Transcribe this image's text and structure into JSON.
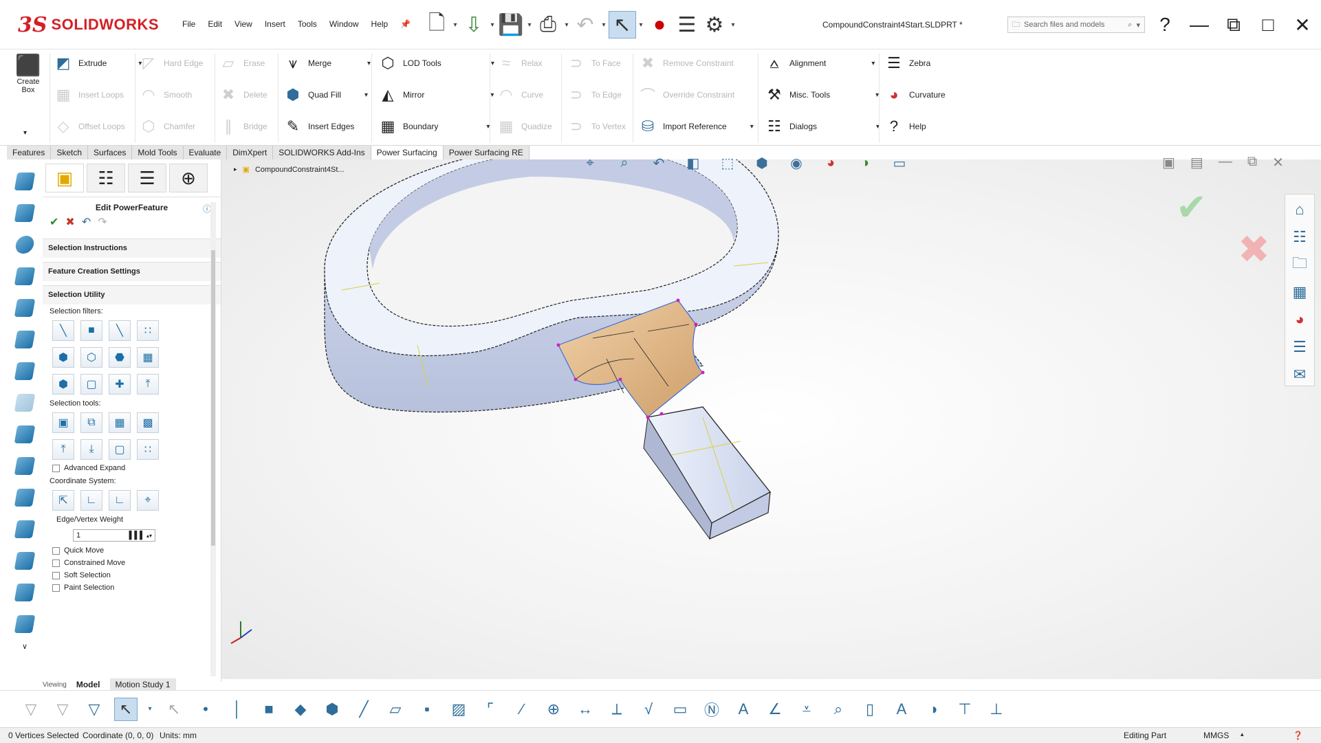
{
  "app": {
    "brand_ds": "3S",
    "brand_name": "SOLIDWORKS",
    "document_title": "CompoundConstraint4Start.SLDPRT *",
    "search_placeholder": "Search files and models"
  },
  "menu": [
    "File",
    "Edit",
    "View",
    "Insert",
    "Tools",
    "Window",
    "Help"
  ],
  "ribbon": {
    "create_box": "Create Box",
    "col1": [
      {
        "label": "Extrude",
        "enabled": true,
        "icon": "extrude-icon"
      },
      {
        "label": "Insert Loops",
        "enabled": false,
        "icon": "insert-loops-icon"
      },
      {
        "label": "Offset Loops",
        "enabled": false,
        "icon": "offset-loops-icon"
      }
    ],
    "col2": [
      {
        "label": "Hard Edge",
        "enabled": false
      },
      {
        "label": "Smooth",
        "enabled": false
      },
      {
        "label": "Chamfer",
        "enabled": false
      }
    ],
    "col3": [
      {
        "label": "Erase",
        "enabled": false
      },
      {
        "label": "Delete",
        "enabled": false
      },
      {
        "label": "Bridge",
        "enabled": false
      }
    ],
    "col4": [
      {
        "label": "Merge",
        "enabled": true
      },
      {
        "label": "Quad Fill",
        "enabled": true
      },
      {
        "label": "Insert Edges",
        "enabled": true
      }
    ],
    "col5": [
      {
        "label": "LOD Tools",
        "enabled": true
      },
      {
        "label": "Mirror",
        "enabled": true
      },
      {
        "label": "Boundary",
        "enabled": true
      }
    ],
    "col6": [
      {
        "label": "Relax",
        "enabled": false
      },
      {
        "label": "Curve",
        "enabled": false
      },
      {
        "label": "Quadize",
        "enabled": false
      }
    ],
    "col7": [
      {
        "label": "To Face",
        "enabled": false
      },
      {
        "label": "To Edge",
        "enabled": false
      },
      {
        "label": "To Vertex",
        "enabled": false
      }
    ],
    "col8": [
      {
        "label": "Remove Constraint",
        "enabled": false
      },
      {
        "label": "Override Constraint",
        "enabled": false
      },
      {
        "label": "Import Reference",
        "enabled": true
      }
    ],
    "col9": [
      {
        "label": "Alignment",
        "enabled": true
      },
      {
        "label": "Misc. Tools",
        "enabled": true
      },
      {
        "label": "Dialogs",
        "enabled": true
      }
    ],
    "col10": [
      {
        "label": "Zebra",
        "enabled": true
      },
      {
        "label": "Curvature",
        "enabled": true
      },
      {
        "label": "Help",
        "enabled": true
      }
    ]
  },
  "tabs": [
    "Features",
    "Sketch",
    "Surfaces",
    "Mold Tools",
    "Evaluate",
    "DimXpert",
    "SOLIDWORKS Add-Ins",
    "Power Surfacing",
    "Power Surfacing RE"
  ],
  "active_tab": "Power Surfacing",
  "panel": {
    "title": "Edit PowerFeature",
    "sections": {
      "selection_instructions": "Selection Instructions",
      "feature_creation_settings": "Feature Creation Settings",
      "selection_utility": "Selection Utility"
    },
    "selection_filters_label": "Selection filters:",
    "selection_tools_label": "Selection tools:",
    "advanced_expand": "Advanced Expand",
    "coordinate_system_label": "Coordinate System:",
    "edge_vertex_weight_label": "Edge/Vertex Weight",
    "weight_value": "1",
    "checkboxes": [
      "Quick Move",
      "Constrained Move",
      "Soft Selection",
      "Paint Selection"
    ],
    "viewing_label": "Viewing"
  },
  "tree": {
    "root": "CompoundConstraint4St..."
  },
  "bottom_tabs": {
    "model": "Model",
    "motion_study": "Motion Study 1"
  },
  "status": {
    "selected": "0 Vertices Selected",
    "coordinate": "Coordinate (0, 0, 0)",
    "units": "Units: mm",
    "mode": "Editing Part",
    "unit_system": "MMGS"
  },
  "colors": {
    "brand_red": "#d41f26",
    "body_face": "#eef2fb",
    "body_side": "#c9d3ea",
    "selected_face": "#e2bc8c",
    "edge_yellow": "#d8d040",
    "vertex_magenta": "#d020c0"
  }
}
